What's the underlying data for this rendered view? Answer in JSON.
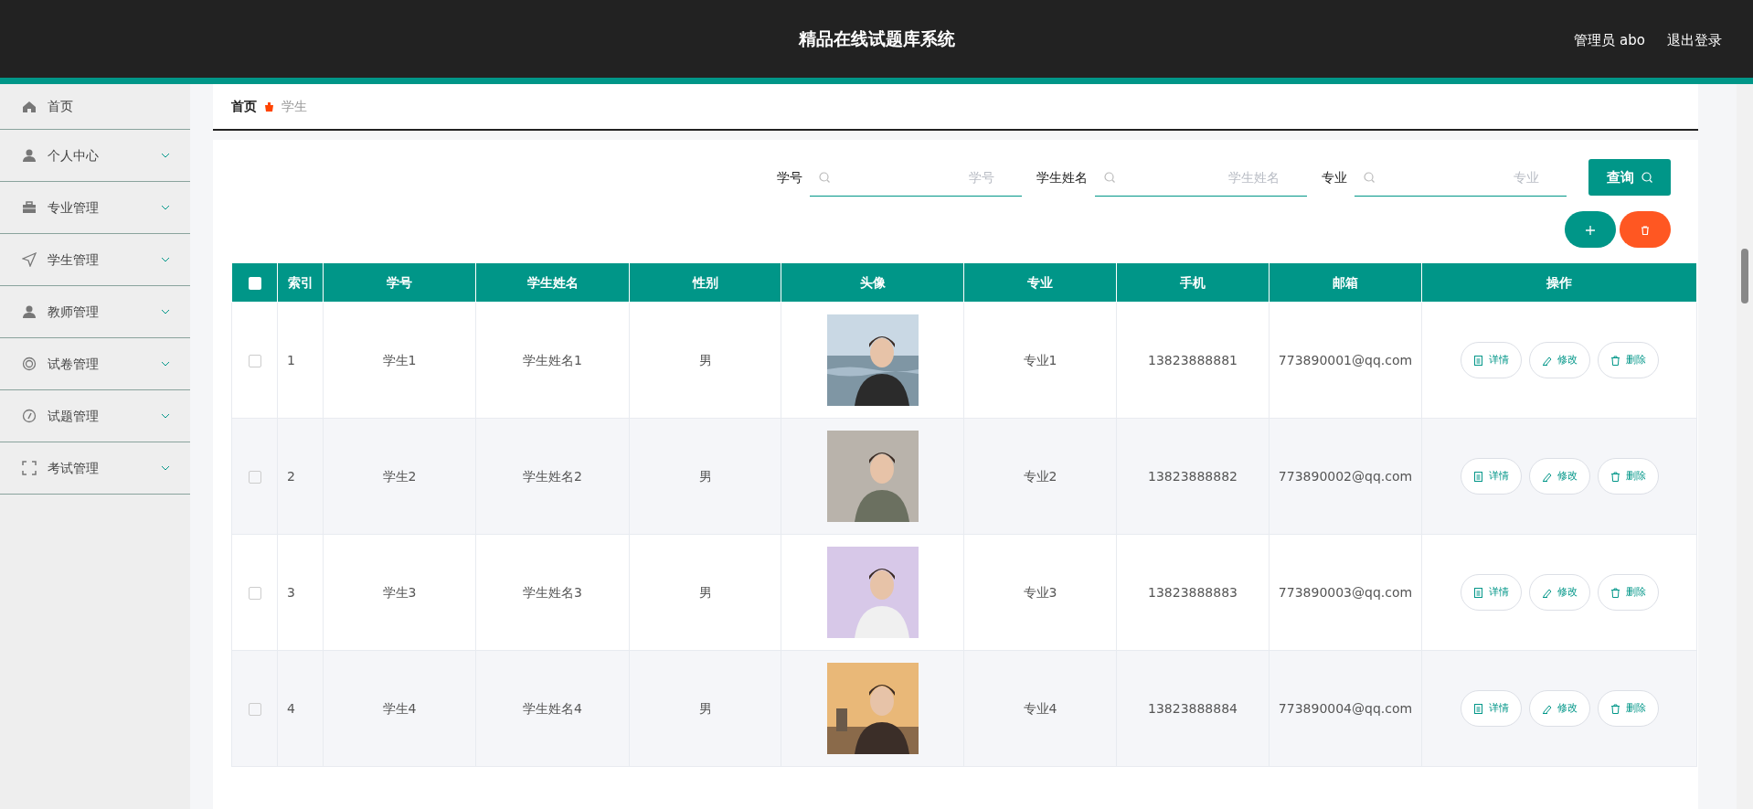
{
  "header": {
    "title": "精品在线试题库系统",
    "user": "管理员 abo",
    "logout": "退出登录"
  },
  "sidebar": {
    "items": [
      {
        "label": "首页",
        "expandable": false
      },
      {
        "label": "个人中心",
        "expandable": true
      },
      {
        "label": "专业管理",
        "expandable": true
      },
      {
        "label": "学生管理",
        "expandable": true
      },
      {
        "label": "教师管理",
        "expandable": true
      },
      {
        "label": "试卷管理",
        "expandable": true
      },
      {
        "label": "试题管理",
        "expandable": true
      },
      {
        "label": "考试管理",
        "expandable": true
      }
    ]
  },
  "breadcrumb": [
    {
      "label": "首页",
      "selected": false
    },
    {
      "label": "学生",
      "selected": true
    }
  ],
  "search": {
    "fields": [
      {
        "label": "学号",
        "placeholder": "学号"
      },
      {
        "label": "学生姓名",
        "placeholder": "学生姓名"
      },
      {
        "label": "专业",
        "placeholder": "专业"
      }
    ],
    "button": "查询"
  },
  "table": {
    "select_all": {
      "checked": false
    },
    "columns": [
      "索引",
      "学号",
      "学生姓名",
      "性别",
      "头像",
      "专业",
      "手机",
      "邮箱",
      "操作"
    ],
    "rows": [
      {
        "checked": false,
        "index": "1",
        "student_id": "学生1",
        "name": "学生姓名1",
        "gender": "男",
        "major": "专业1",
        "phone": "13823888881",
        "email": "773890001@qq.com",
        "actions": [
          "详情",
          "修改",
          "删除"
        ]
      },
      {
        "checked": false,
        "index": "2",
        "student_id": "学生2",
        "name": "学生姓名2",
        "gender": "男",
        "major": "专业2",
        "phone": "13823888882",
        "email": "773890002@qq.com",
        "actions": [
          "详情",
          "修改",
          "删除"
        ]
      },
      {
        "checked": false,
        "index": "3",
        "student_id": "学生3",
        "name": "学生姓名3",
        "gender": "男",
        "major": "专业3",
        "phone": "13823888883",
        "email": "773890003@qq.com",
        "actions": [
          "详情",
          "修改",
          "删除"
        ]
      },
      {
        "checked": false,
        "index": "4",
        "student_id": "学生4",
        "name": "学生姓名4",
        "gender": "男",
        "major": "专业4",
        "phone": "13823888884",
        "email": "773890004@qq.com",
        "actions": [
          "详情",
          "修改",
          "删除"
        ]
      }
    ]
  }
}
